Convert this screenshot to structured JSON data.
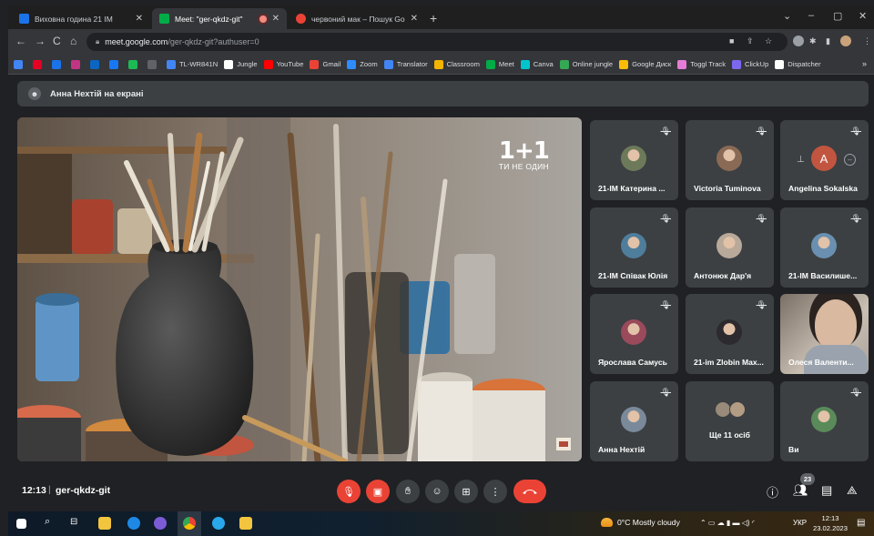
{
  "browser": {
    "tabs": [
      {
        "label": "Виховна година 21 ІМ",
        "icon": "classroom-icon",
        "color": "#1a73e8"
      },
      {
        "label": "Meet: \"ger-qkdz-git\"",
        "icon": "meet-icon",
        "color": "#00ac47",
        "recording": true
      },
      {
        "label": "червоний мак – Пошук Google",
        "icon": "google-icon",
        "color": "#ea4335"
      }
    ],
    "url_host": "meet.google.com",
    "url_path": "/ger-qkdz-git?authuser=0",
    "bookmarks": [
      {
        "label": "",
        "icon": "apps-icon",
        "color": "#4285f4"
      },
      {
        "label": "",
        "icon": "pinterest-icon",
        "color": "#e60023"
      },
      {
        "label": "",
        "icon": "translate-icon",
        "color": "#1a73e8"
      },
      {
        "label": "",
        "icon": "instagram-icon",
        "color": "#c13584"
      },
      {
        "label": "",
        "icon": "linkedin-icon",
        "color": "#0a66c2"
      },
      {
        "label": "",
        "icon": "facebook-icon",
        "color": "#1877f2"
      },
      {
        "label": "",
        "icon": "spotify-icon",
        "color": "#1db954"
      },
      {
        "label": "",
        "icon": "setup-icon",
        "color": "#5f6368"
      },
      {
        "label": "TL-WR841N",
        "icon": "router-icon",
        "color": "#4285f4"
      },
      {
        "label": "Jungle",
        "icon": "jungle-icon",
        "color": "#ffffff"
      },
      {
        "label": "YouTube",
        "icon": "youtube-icon",
        "color": "#ff0000"
      },
      {
        "label": "Gmail",
        "icon": "gmail-icon",
        "color": "#ea4335"
      },
      {
        "label": "Zoom",
        "icon": "zoom-icon",
        "color": "#2d8cff"
      },
      {
        "label": "Translator",
        "icon": "translator-icon",
        "color": "#4285f4"
      },
      {
        "label": "Classroom",
        "icon": "classroom-icon",
        "color": "#f4b400"
      },
      {
        "label": "Meet",
        "icon": "meet-icon",
        "color": "#00ac47"
      },
      {
        "label": "Canva",
        "icon": "canva-icon",
        "color": "#00c4cc"
      },
      {
        "label": "Online jungle",
        "icon": "online-jungle-icon",
        "color": "#34a853"
      },
      {
        "label": "Google Диск",
        "icon": "drive-icon",
        "color": "#fbbc04"
      },
      {
        "label": "Toggl Track",
        "icon": "toggl-icon",
        "color": "#e57cd8"
      },
      {
        "label": "ClickUp",
        "icon": "clickup-icon",
        "color": "#7b68ee"
      },
      {
        "label": "Dispatcher",
        "icon": "dispatcher-icon",
        "color": "#ffffff"
      }
    ]
  },
  "meet": {
    "presenting_banner": "Анна Нехтій на екрані",
    "stage_logo": {
      "main": "1+1",
      "tagline": "ТИ НЕ ОДИН"
    },
    "participants": [
      {
        "name": "21-ІМ Катерина ...",
        "muted": true,
        "avatar_color": "#6d7a5a"
      },
      {
        "name": "Victoria Tuminova",
        "muted": true,
        "avatar_color": "#8a6a55"
      },
      {
        "name": "Angelina Sokalska",
        "muted": true,
        "avatar_letter": "A",
        "avatar_color": "#c2553f"
      },
      {
        "name": "21-ІМ Співак Юлія",
        "muted": true,
        "avatar_color": "#4f7d9c"
      },
      {
        "name": "Антонюк Дар'я",
        "muted": true,
        "avatar_color": "#b8a99a"
      },
      {
        "name": "21-ІМ Василише...",
        "muted": true,
        "avatar_color": "#6a8fb0"
      },
      {
        "name": "Ярослава Самусь",
        "muted": true,
        "avatar_color": "#9a4a5a"
      },
      {
        "name": "21-im Zlobin Max...",
        "muted": true,
        "avatar_color": "#2c2a2e"
      },
      {
        "name": "Олеся Валенти...",
        "muted": false,
        "avatar_color": "#b9b0a6"
      },
      {
        "name": "Анна Нехтій",
        "muted": true,
        "avatar_color": "#7a8a9a"
      },
      {
        "name": "Ще 11 осіб",
        "muted": false,
        "avatar_color": "#9a8a7a"
      },
      {
        "name": "Ви",
        "muted": true,
        "avatar_color": "#5a8a5a"
      }
    ],
    "time": "12:13",
    "meeting_code": "ger-qkdz-git",
    "participant_count": "23"
  },
  "taskbar": {
    "weather": "0°C  Mostly cloudy",
    "lang": "УКР",
    "time": "12:13",
    "date": "23.02.2023",
    "notif_count": "2"
  }
}
